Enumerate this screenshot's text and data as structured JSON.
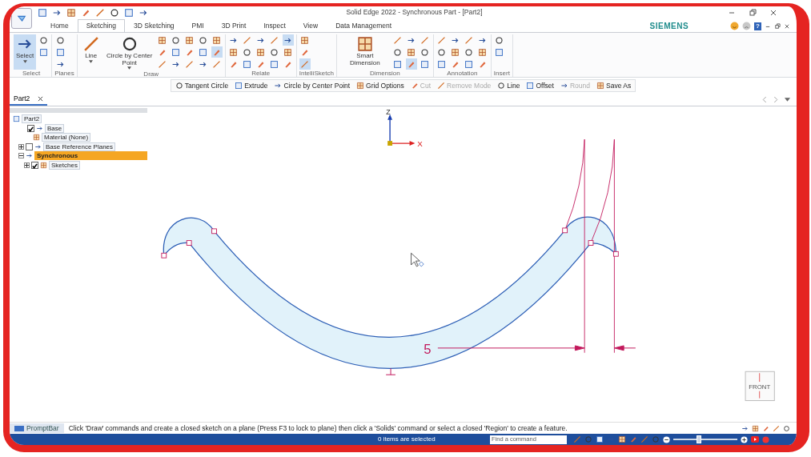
{
  "window": {
    "title": "Solid Edge 2022 - Synchronous Part - [Part2]"
  },
  "brand": "SIEMENS",
  "help": "?",
  "tabs": [
    {
      "label": "Home",
      "selected": false
    },
    {
      "label": "Sketching",
      "selected": true
    },
    {
      "label": "3D Sketching",
      "selected": false
    },
    {
      "label": "PMI",
      "selected": false
    },
    {
      "label": "3D Print",
      "selected": false
    },
    {
      "label": "Inspect",
      "selected": false
    },
    {
      "label": "View",
      "selected": false
    },
    {
      "label": "Data Management",
      "selected": false
    }
  ],
  "ribbon": [
    {
      "label": "Select",
      "tools": [
        {
          "kind": "big",
          "label": "Select",
          "selected": true,
          "caret": true
        },
        {
          "kind": "small",
          "selected": false
        },
        {
          "kind": "small",
          "selected": false
        }
      ]
    },
    {
      "label": "Planes",
      "tools": [
        {
          "kind": "small",
          "selected": false
        },
        {
          "kind": "small",
          "selected": false
        },
        {
          "kind": "small",
          "selected": false
        }
      ]
    },
    {
      "label": "Draw",
      "tools": [
        {
          "kind": "big",
          "label": "Line",
          "selected": false,
          "caret": true
        },
        {
          "kind": "big",
          "label": "Circle by Center Point",
          "selected": false,
          "caret": true
        },
        {
          "kind": "small",
          "selected": false
        },
        {
          "kind": "small",
          "selected": false
        },
        {
          "kind": "small",
          "selected": false
        },
        {
          "kind": "small",
          "selected": false
        },
        {
          "kind": "small",
          "selected": false
        },
        {
          "kind": "small",
          "selected": false
        },
        {
          "kind": "small",
          "selected": false
        },
        {
          "kind": "small",
          "selected": false
        },
        {
          "kind": "small",
          "selected": false
        },
        {
          "kind": "small",
          "selected": false
        },
        {
          "kind": "small",
          "selected": false
        },
        {
          "kind": "small",
          "selected": false
        },
        {
          "kind": "small",
          "selected": false
        },
        {
          "kind": "small",
          "selected": true
        },
        {
          "kind": "small",
          "selected": false
        }
      ]
    },
    {
      "label": "Relate",
      "tools": [
        {
          "kind": "small",
          "selected": false
        },
        {
          "kind": "small",
          "selected": false
        },
        {
          "kind": "small",
          "selected": false
        },
        {
          "kind": "small",
          "selected": false
        },
        {
          "kind": "small",
          "selected": false
        },
        {
          "kind": "small",
          "selected": false
        },
        {
          "kind": "small",
          "selected": false
        },
        {
          "kind": "small",
          "selected": false
        },
        {
          "kind": "small",
          "selected": false
        },
        {
          "kind": "small",
          "selected": false
        },
        {
          "kind": "small",
          "selected": false
        },
        {
          "kind": "small",
          "selected": false
        },
        {
          "kind": "small",
          "selected": true
        },
        {
          "kind": "small",
          "selected": false
        },
        {
          "kind": "small",
          "selected": false
        }
      ]
    },
    {
      "label": "IntelliSketch",
      "tools": [
        {
          "kind": "small",
          "selected": false
        },
        {
          "kind": "small",
          "selected": false
        },
        {
          "kind": "small",
          "selected": true
        }
      ]
    },
    {
      "label": "Dimension",
      "tools": [
        {
          "kind": "big",
          "label": "Smart Dimension",
          "selected": false,
          "caret": false
        },
        {
          "kind": "small",
          "selected": false
        },
        {
          "kind": "small",
          "selected": false
        },
        {
          "kind": "small",
          "selected": false
        },
        {
          "kind": "small",
          "selected": false
        },
        {
          "kind": "small",
          "selected": false
        },
        {
          "kind": "small",
          "selected": true
        },
        {
          "kind": "small",
          "selected": false
        },
        {
          "kind": "small",
          "selected": false
        },
        {
          "kind": "small",
          "selected": false
        }
      ]
    },
    {
      "label": "Annotation",
      "tools": [
        {
          "kind": "small",
          "selected": false
        },
        {
          "kind": "small",
          "selected": false
        },
        {
          "kind": "small",
          "selected": false
        },
        {
          "kind": "small",
          "selected": false
        },
        {
          "kind": "small",
          "selected": false
        },
        {
          "kind": "small",
          "selected": false
        },
        {
          "kind": "small",
          "selected": false
        },
        {
          "kind": "small",
          "selected": false
        },
        {
          "kind": "small",
          "selected": false
        },
        {
          "kind": "small",
          "selected": false
        },
        {
          "kind": "small",
          "selected": false
        },
        {
          "kind": "small",
          "selected": false
        }
      ]
    },
    {
      "label": "Insert",
      "tools": [
        {
          "kind": "small",
          "selected": false
        },
        {
          "kind": "small",
          "selected": false
        }
      ]
    }
  ],
  "command_bar": [
    {
      "label": "Tangent Circle",
      "disabled": false
    },
    {
      "label": "Extrude",
      "disabled": false
    },
    {
      "label": "Circle by Center Point",
      "disabled": false
    },
    {
      "label": "Grid Options",
      "disabled": false
    },
    {
      "label": "Cut",
      "disabled": true
    },
    {
      "label": "Remove Mode",
      "disabled": true
    },
    {
      "label": "Line",
      "disabled": false
    },
    {
      "label": "Offset",
      "disabled": false
    },
    {
      "label": "Round",
      "disabled": true
    },
    {
      "label": "Save As",
      "disabled": false
    }
  ],
  "document_tabs": [
    {
      "label": "Part2",
      "selected": true
    }
  ],
  "tree": [
    {
      "label": "Part2",
      "selected": false,
      "children": [
        {
          "label": "Base",
          "selected": false,
          "checked": true,
          "children": [
            {
              "label": "Material (None)",
              "selected": false
            }
          ]
        },
        {
          "label": "Base Reference Planes",
          "selected": false,
          "checked": false,
          "expanded": false
        },
        {
          "label": "Synchronous",
          "selected": true,
          "expanded": true,
          "children": [
            {
              "label": "Sketches",
              "selected": false,
              "checked": true,
              "expanded": false
            }
          ]
        }
      ]
    }
  ],
  "canvas": {
    "axis_labels": [
      "Z",
      "X"
    ],
    "dimension": "5",
    "view_cube": "FRONT"
  },
  "prompt_bar": {
    "label": "PromptBar",
    "message": "Click 'Draw' commands and create a closed sketch on a plane (Press F3 to lock to plane) then click a 'Solids' command or select a closed 'Region' to create a feature."
  },
  "status_bar": {
    "selection": "0 items are selected",
    "search": {
      "placeholder": "Find a command"
    },
    "zoom": {
      "level": 0.4
    }
  }
}
